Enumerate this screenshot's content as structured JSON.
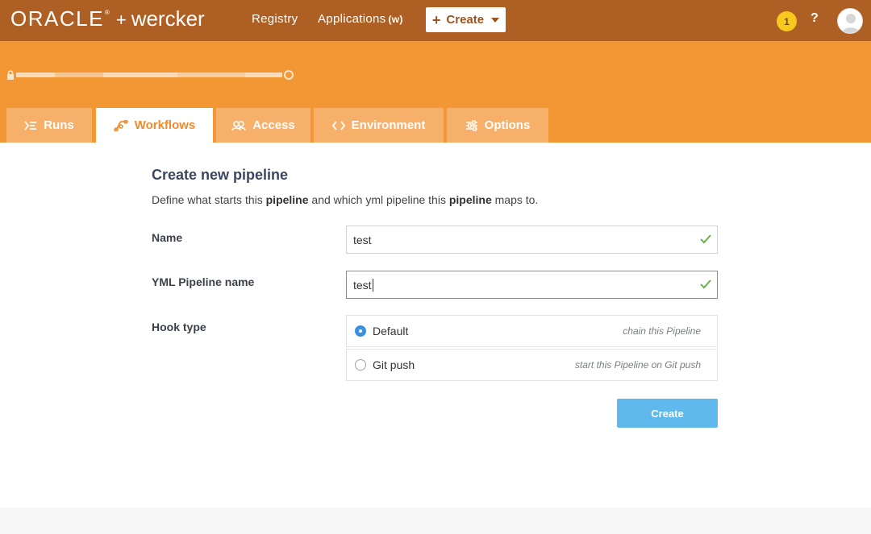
{
  "topbar": {
    "brand_oracle": "ORACLE",
    "brand_tm": "®",
    "brand_plus": "+",
    "brand_wercker": "wercker",
    "registry": "Registry",
    "applications": "Applications",
    "applications_badge": "(w)",
    "create_label": "Create",
    "notification_count": "1",
    "help_label": "?"
  },
  "tabs": [
    {
      "label": "Runs",
      "icon": "runs-icon"
    },
    {
      "label": "Workflows",
      "icon": "workflows-icon",
      "active": true
    },
    {
      "label": "Access",
      "icon": "access-icon"
    },
    {
      "label": "Environment",
      "icon": "code-brackets-icon"
    },
    {
      "label": "Options",
      "icon": "sliders-icon"
    }
  ],
  "form": {
    "title": "Create new pipeline",
    "description_parts": [
      "Define what starts this ",
      "pipeline",
      " and which yml pipeline this ",
      "pipeline",
      " maps to."
    ],
    "name_label": "Name",
    "name_value": "test",
    "yml_label": "YML Pipeline name",
    "yml_value": "test",
    "hook_label": "Hook type",
    "hook_options": [
      {
        "label": "Default",
        "hint": "chain this Pipeline",
        "selected": true
      },
      {
        "label": "Git push",
        "hint": "start this Pipeline on Git push",
        "selected": false
      }
    ],
    "submit_label": "Create"
  },
  "colors": {
    "topbar": "#ad5f24",
    "header": "#f39735",
    "tab_inactive": "#f6b06a",
    "active_tab_text": "#ef8a2d",
    "submit": "#5fb9ec",
    "valid_check": "#6ab04c",
    "radio_selected": "#3d8fe0"
  }
}
